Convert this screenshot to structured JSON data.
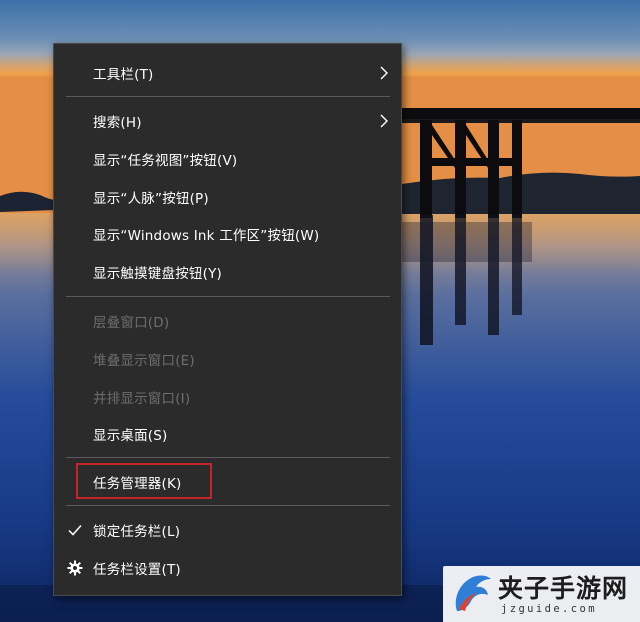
{
  "context_menu": {
    "items": [
      {
        "id": "toolbars",
        "label": "工具栏(T)",
        "enabled": true,
        "submenu": true
      },
      {
        "id": "search",
        "label": "搜索(H)",
        "enabled": true,
        "submenu": true
      },
      {
        "id": "show_task_view",
        "label": "显示“任务视图”按钮(V)",
        "enabled": true
      },
      {
        "id": "show_people",
        "label": "显示“人脉”按钮(P)",
        "enabled": true
      },
      {
        "id": "show_ink",
        "label": "显示“Windows Ink 工作区”按钮(W)",
        "enabled": true
      },
      {
        "id": "show_touch_keyboard",
        "label": "显示触摸键盘按钮(Y)",
        "enabled": true
      },
      {
        "id": "cascade",
        "label": "层叠窗口(D)",
        "enabled": false
      },
      {
        "id": "stacked",
        "label": "堆叠显示窗口(E)",
        "enabled": false
      },
      {
        "id": "side_by_side",
        "label": "并排显示窗口(I)",
        "enabled": false
      },
      {
        "id": "show_desktop",
        "label": "显示桌面(S)",
        "enabled": true
      },
      {
        "id": "task_manager",
        "label": "任务管理器(K)",
        "enabled": true,
        "highlighted": true
      },
      {
        "id": "lock_taskbar",
        "label": "锁定任务栏(L)",
        "enabled": true,
        "checked": true,
        "icon": "checkmark-icon"
      },
      {
        "id": "taskbar_settings",
        "label": "任务栏设置(T)",
        "enabled": true,
        "icon": "gear-icon"
      }
    ]
  },
  "watermark": {
    "title": "夹子手游网",
    "url": "jzguide.com"
  },
  "colors": {
    "menu_bg": "#2b2b2b",
    "menu_text": "#ffffff",
    "disabled_text": "#6d6d6d",
    "separator": "#5a5a5a",
    "highlight_border": "#c0262b"
  }
}
